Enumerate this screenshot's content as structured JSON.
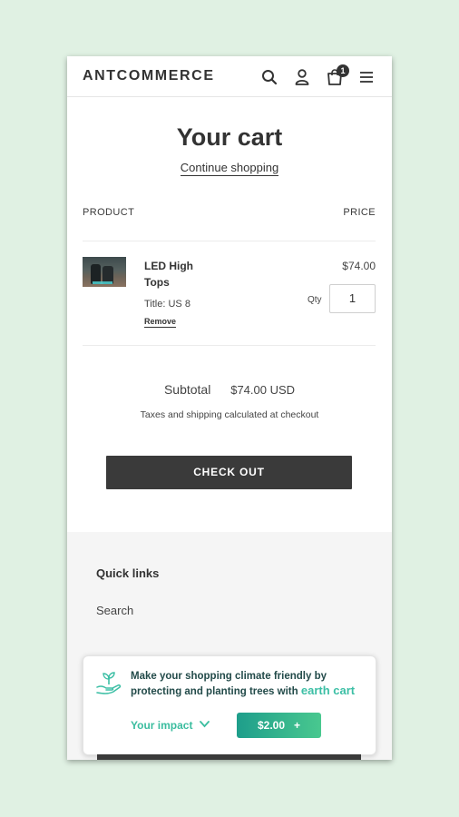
{
  "header": {
    "logo": "ANTCOMMERCE",
    "cart_count": "1"
  },
  "cart": {
    "title": "Your cart",
    "continue_label": "Continue shopping",
    "col_product": "PRODUCT",
    "col_price": "PRICE",
    "items": [
      {
        "name": "LED High Tops",
        "variant": "Title: US 8",
        "remove_label": "Remove",
        "price": "$74.00",
        "qty_label": "Qty",
        "qty": "1"
      }
    ],
    "subtotal_label": "Subtotal",
    "subtotal_value": "$74.00 USD",
    "tax_note": "Taxes and shipping calculated at checkout",
    "checkout_label": "CHECK OUT"
  },
  "footer": {
    "quick_links_title": "Quick links",
    "links": [
      "Search"
    ]
  },
  "earthcart": {
    "message": "Make your shopping climate friendly by protecting and planting trees with",
    "brand": "earth cart",
    "impact_label": "Your impact",
    "amount": "$2.00",
    "plus": "+"
  },
  "colors": {
    "background": "#e0f1e3",
    "checkout_button": "#3a3a3a",
    "earthcart_accent": "#3cbfa5"
  }
}
